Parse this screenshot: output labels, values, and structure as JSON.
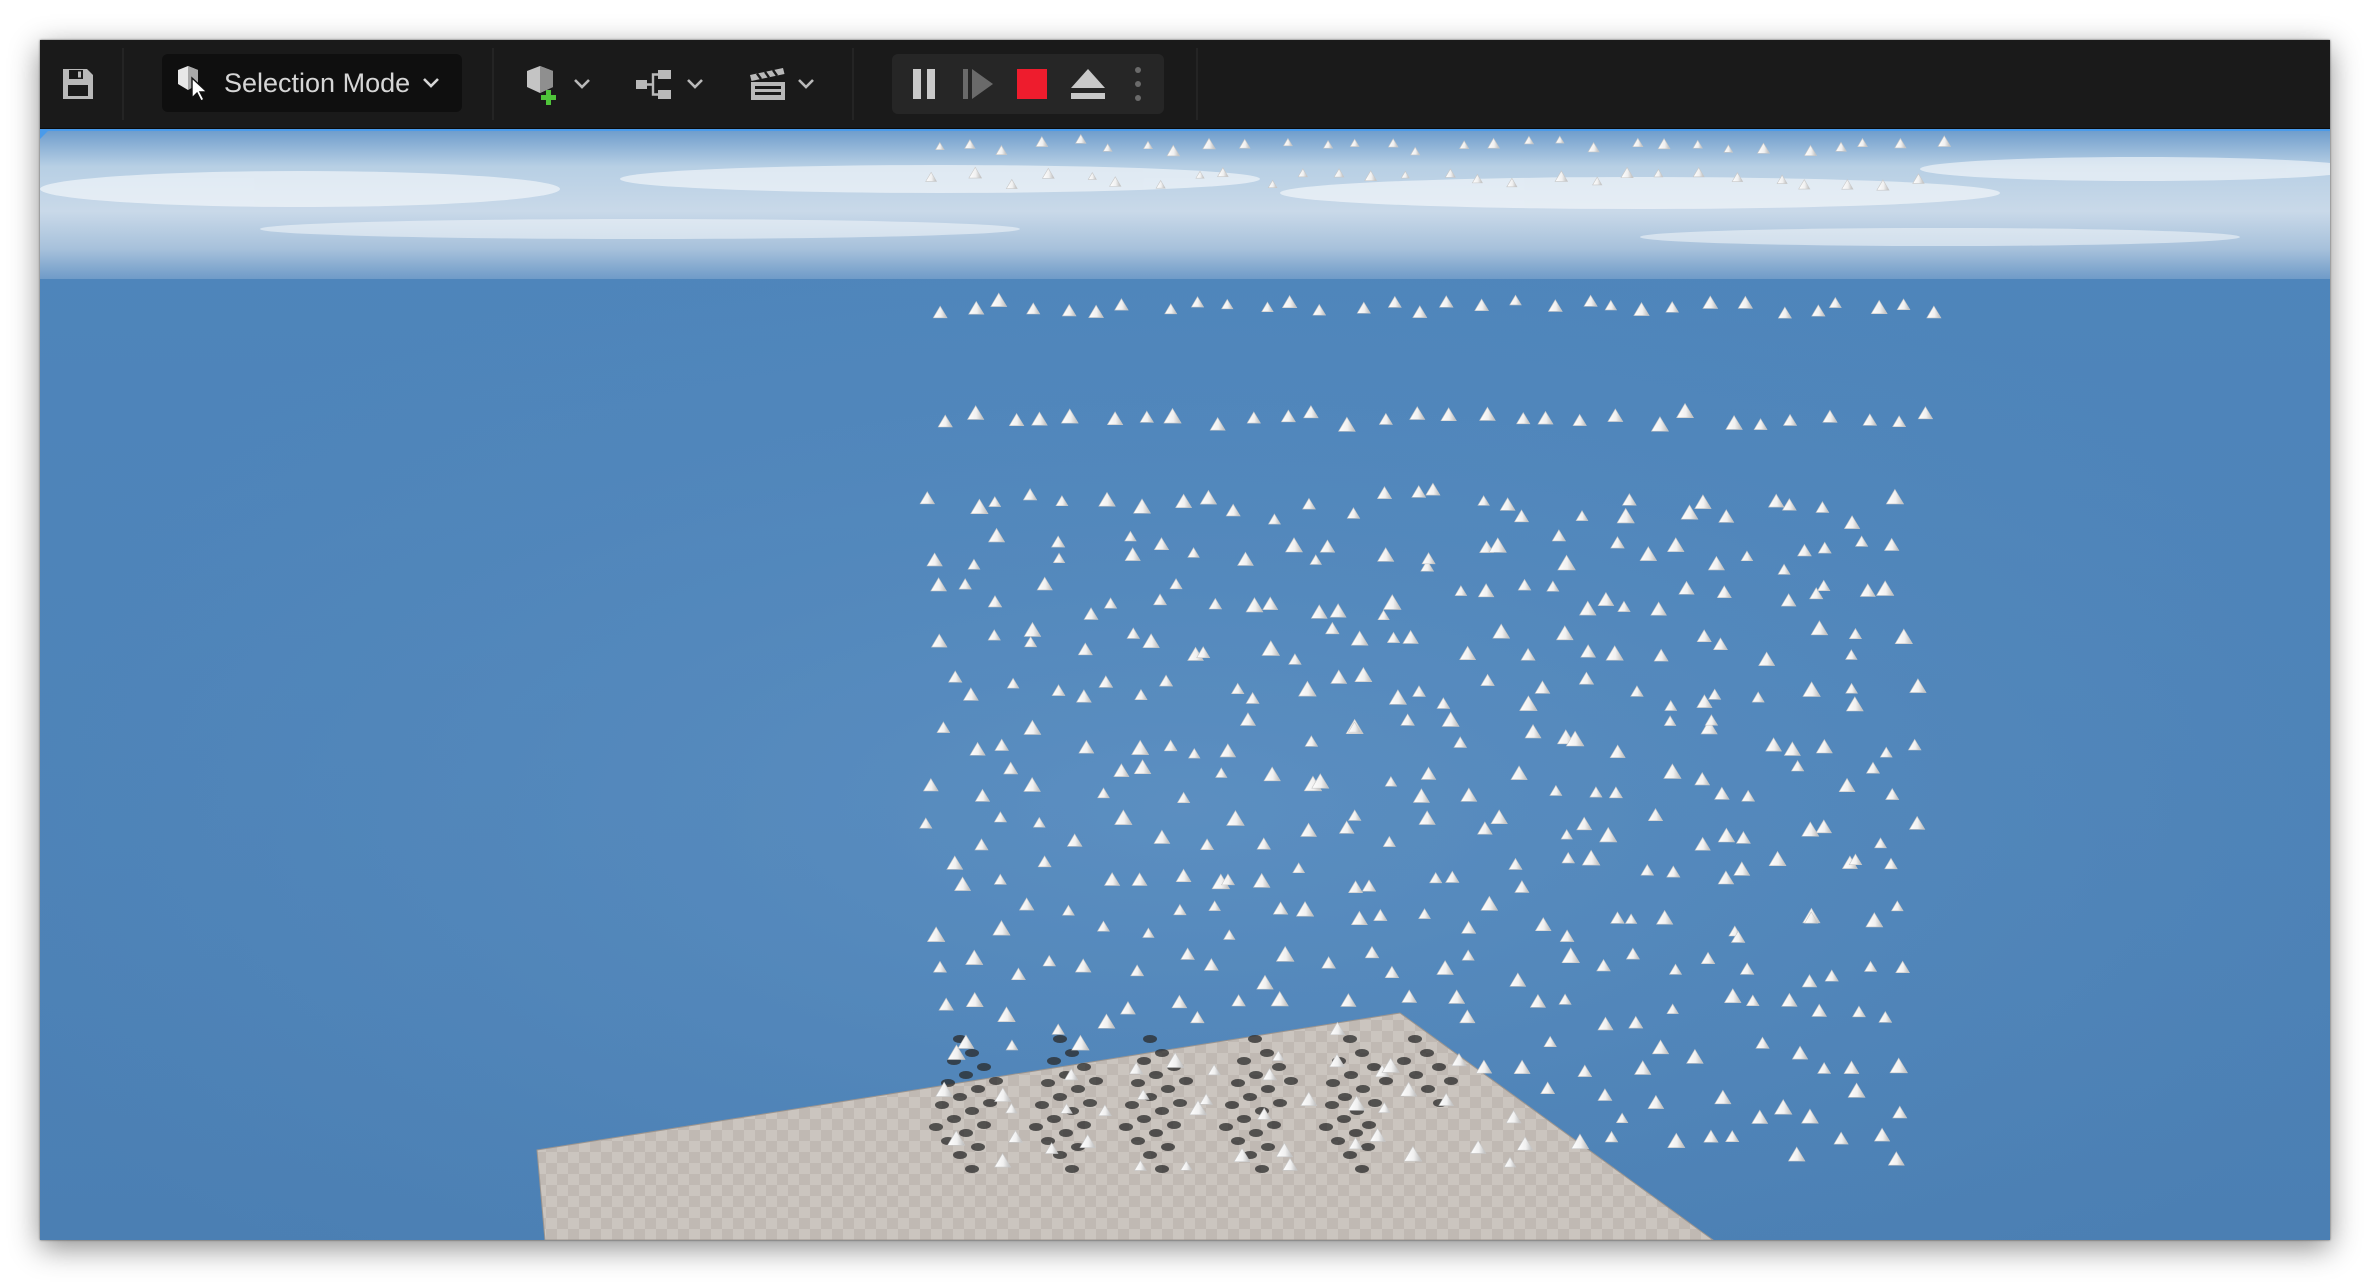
{
  "toolbar": {
    "save_icon": "save-icon",
    "mode": {
      "label": "Selection Mode",
      "icon": "select-mode-icon"
    },
    "quick_add_icon": "add-actor-icon",
    "blueprints_icon": "blueprint-graph-icon",
    "cinematics_icon": "clapperboard-icon",
    "play_controls": {
      "pause_icon": "pause-icon",
      "advance_frame_icon": "advance-frame-icon",
      "stop_icon": "stop-icon",
      "eject_icon": "eject-icon",
      "options_icon": "more-options-icon"
    }
  },
  "colors": {
    "toolbar_bg": "#1a1a1a",
    "icon_gray": "#b9b9b9",
    "add_green": "#4fc43a",
    "stop_red": "#ee1c2d",
    "sky_blue": "#578dc0",
    "floor": "#c8c2bc"
  },
  "viewport": {
    "scene": "level-viewport",
    "objects": "particle-cones-grid",
    "floor": "checker-floor-plane"
  }
}
